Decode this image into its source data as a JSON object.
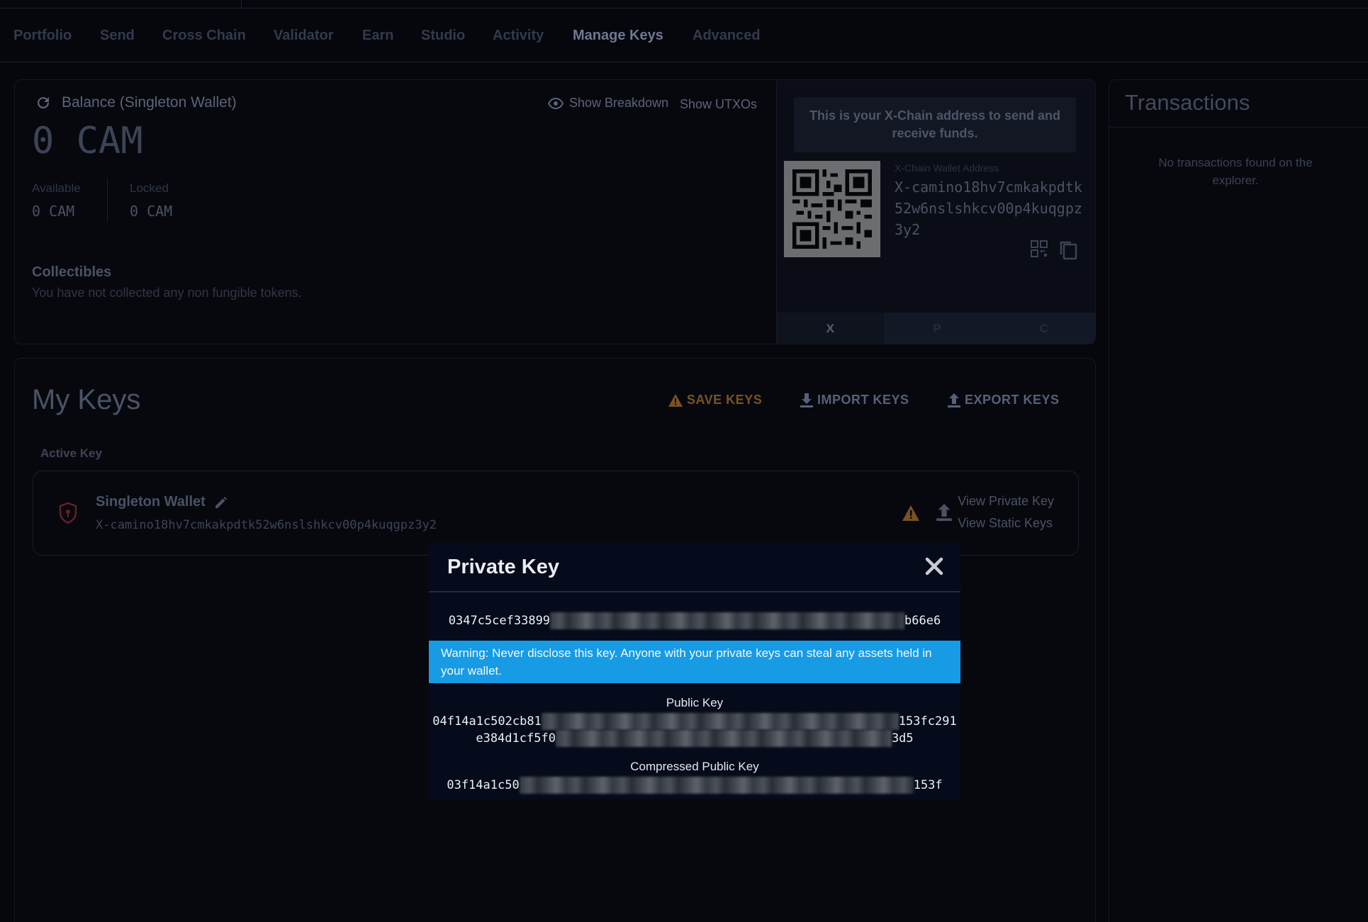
{
  "nav": {
    "items": [
      "Portfolio",
      "Send",
      "Cross Chain",
      "Validator",
      "Earn",
      "Studio",
      "Activity",
      "Manage Keys",
      "Advanced"
    ],
    "active": "Manage Keys"
  },
  "balance": {
    "title": "Balance (Singleton Wallet)",
    "amount": "0 CAM",
    "show_breakdown": "Show Breakdown",
    "show_utxos": "Show UTXOs",
    "available_label": "Available",
    "available_value": "0 CAM",
    "locked_label": "Locked",
    "locked_value": "0 CAM"
  },
  "collectibles": {
    "title": "Collectibles",
    "empty": "You have not collected any non fungible tokens."
  },
  "address_box": {
    "note": "This is your X-Chain address to send and receive funds.",
    "label": "X-Chain Wallet Address",
    "value": "X-camino18hv7cmkakpdtk52w6nslshkcv00p4kuqgpz3y2",
    "chains": [
      "X",
      "P",
      "C"
    ],
    "active_chain": "X"
  },
  "my_keys": {
    "title": "My Keys",
    "save_keys": "SAVE KEYS",
    "import_keys": "IMPORT KEYS",
    "export_keys": "EXPORT KEYS",
    "active_key_label": "Active Key",
    "wallet_name": "Singleton Wallet",
    "wallet_address": "X-camino18hv7cmkakpdtk52w6nslshkcv00p4kuqgpz3y2",
    "view_private_key": "View Private Key",
    "view_static_keys": "View Static Keys"
  },
  "transactions": {
    "title": "Transactions",
    "empty": "No transactions found on the explorer."
  },
  "modal": {
    "title": "Private Key",
    "private_key_start": "0347c5cef33899",
    "private_key_end": "b66e6",
    "warning": "Warning: Never disclose this key. Anyone with your private keys can steal any assets held in your wallet.",
    "public_key_label": "Public Key",
    "public_key_line1_start": "04f14a1c502cb81",
    "public_key_line1_end": "153fc291",
    "public_key_line2_start": "e384d1cf5f0",
    "public_key_line2_end": "3d5",
    "compressed_label": "Compressed Public Key",
    "compressed_start": "03f14a1c50",
    "compressed_end": "153f"
  },
  "colors": {
    "background": "#05070d",
    "warning_banner": "#179be4",
    "save_keys": "#7a5220",
    "modal_bg": "#050b1a"
  }
}
